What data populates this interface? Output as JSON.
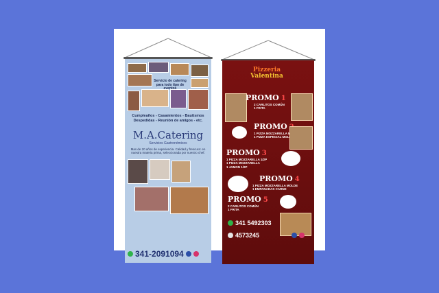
{
  "left_banner": {
    "caption_service": "Servicio de catering\npara todo tipo de eventos",
    "events_line1": "Cumpleaños - Casamientos - Bautismos",
    "events_line2": "Despedidas - Reunión de amigos - etc.",
    "brand_name": "M.A.Catering",
    "brand_sub": "Servicios Gastronómicos",
    "experience": "Mas de 20 años de experiencia. Calidad y frescura: en nuestra materia prima, seleccionada por nuestro chef.",
    "phone": "341-2091094",
    "icons": [
      "whatsapp-icon",
      "facebook-icon",
      "instagram-icon"
    ],
    "colors": {
      "background": "#b8cde6",
      "text": "#203070"
    }
  },
  "right_banner": {
    "logo_line1": "Pizzeria",
    "logo_line2": "Valentina",
    "promos": [
      {
        "title": "PROMO",
        "number": "1",
        "desc": "2 CARLITOS COMÚN\n1 FRITA"
      },
      {
        "title": "PROMO",
        "number": "2",
        "desc": "1 PIZZA MOZZARELLA MOLDE\n1 PIZZA ESPECIAL MOLDE"
      },
      {
        "title": "PROMO",
        "number": "3",
        "desc": "1 PIZZA MOZZARELLA 1/2P\n1 PIZZA MOZZARELLA\n1 JAMON 1/2P"
      },
      {
        "title": "PROMO",
        "number": "4",
        "desc": "1 PIZZA MOZZARELLA MOLDE\n1 EMPANADAS CARNE"
      },
      {
        "title": "PROMO",
        "number": "5",
        "desc": "2 CARLITOS COMÚN\n1 FRITA"
      }
    ],
    "phone_whatsapp": "341 5492303",
    "phone_landline": "4573245",
    "icons": [
      "whatsapp-icon",
      "phone-icon",
      "facebook-icon",
      "instagram-icon"
    ],
    "colors": {
      "background": "#6e0f0f",
      "promo_number": "#ff4a4a",
      "logo": "#f6c531"
    }
  }
}
